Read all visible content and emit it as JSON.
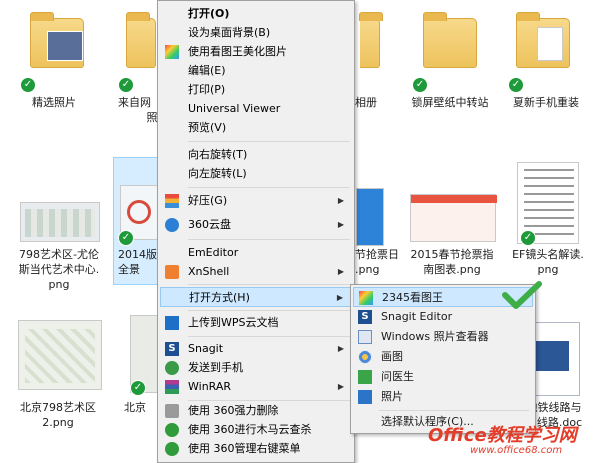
{
  "files": {
    "row1": [
      {
        "label": "精选照片"
      },
      {
        "label": "来自网",
        "label2": "照"
      },
      {
        "label": "相册"
      },
      {
        "label": "锁屏壁纸中转站"
      },
      {
        "label": "夏新手机重装"
      }
    ],
    "row2": [
      {
        "label": "798艺术区-尤伦",
        "label2": "斯当代艺术中心.",
        "label3": "png"
      },
      {
        "label": "2014版",
        "label2": "全景"
      },
      {
        "label": "节抢票日",
        "label2": ".png"
      },
      {
        "label": "2015春节抢票指",
        "label2": "南图表.png"
      },
      {
        "label": "EF镜头名解读.",
        "label2": "png"
      }
    ],
    "row3": [
      {
        "label": "北京798艺术区",
        "label2": "2.png"
      },
      {
        "label": "北京"
      },
      {
        "label": "地铁线路与",
        "label2": "刘线路.doc"
      }
    ]
  },
  "menu": {
    "items": [
      {
        "label": "打开(O)"
      },
      {
        "label": "设为桌面背景(B)"
      },
      {
        "label": "使用看图王美化图片"
      },
      {
        "label": "编辑(E)"
      },
      {
        "label": "打印(P)"
      },
      {
        "label": "Universal Viewer"
      },
      {
        "label": "预览(V)"
      },
      {
        "label": "向右旋转(T)"
      },
      {
        "label": "向左旋转(L)"
      },
      {
        "label": "好压(G)"
      },
      {
        "label": "360云盘"
      },
      {
        "label": "EmEditor"
      },
      {
        "label": "XnShell"
      },
      {
        "label": "打开方式(H)"
      },
      {
        "label": "上传到WPS云文档"
      },
      {
        "label": "Snagit"
      },
      {
        "label": "发送到手机"
      },
      {
        "label": "WinRAR"
      },
      {
        "label": "使用 360强力删除"
      },
      {
        "label": "使用 360进行木马云查杀"
      },
      {
        "label": "使用 360管理右键菜单"
      }
    ]
  },
  "submenu": {
    "items": [
      {
        "label": "2345看图王"
      },
      {
        "label": "Snagit Editor"
      },
      {
        "label": "Windows 照片查看器"
      },
      {
        "label": "画图"
      },
      {
        "label": "问医生"
      },
      {
        "label": "照片"
      },
      {
        "label": "选择默认程序(C)..."
      }
    ]
  },
  "watermark": {
    "line1": "Office教程学习网",
    "line2": "www.office68.com"
  },
  "colors": {
    "highlight": "#cde8ff",
    "check": "#1f9a3a",
    "watermark": "#e33d2a"
  }
}
